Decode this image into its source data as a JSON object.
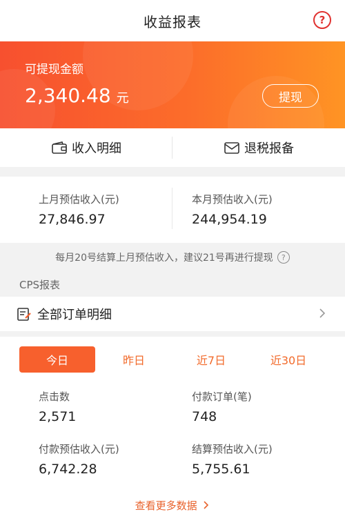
{
  "header": {
    "title": "收益报表",
    "help_icon": "?"
  },
  "balance": {
    "label": "可提现金额",
    "amount": "2,340.48",
    "unit": "元",
    "withdraw_label": "提现"
  },
  "quick_actions": [
    {
      "label": "收入明细",
      "icon": "wallet-icon"
    },
    {
      "label": "退税报备",
      "icon": "envelope-icon"
    }
  ],
  "estimates": {
    "last_month": {
      "label": "上月预估收入(元)",
      "value": "27,846.97"
    },
    "this_month": {
      "label": "本月预估收入(元)",
      "value": "244,954.19"
    }
  },
  "note": {
    "text": "每月20号结算上月预估收入，建议21号再进行提现",
    "icon": "?"
  },
  "section": {
    "label": "CPS报表"
  },
  "orders": {
    "title": "全部订单明细"
  },
  "tabs": [
    {
      "label": "今日",
      "active": true
    },
    {
      "label": "昨日",
      "active": false
    },
    {
      "label": "近7日",
      "active": false
    },
    {
      "label": "近30日",
      "active": false
    }
  ],
  "metrics": {
    "clicks": {
      "label": "点击数",
      "value": "2,571"
    },
    "paid_orders": {
      "label": "付款订单(笔)",
      "value": "748"
    },
    "paid_estimate": {
      "label": "付款预估收入(元)",
      "value": "6,742.28"
    },
    "settled_estimate": {
      "label": "结算预估收入(元)",
      "value": "5,755.61"
    }
  },
  "more_link": {
    "label": "查看更多数据"
  },
  "colors": {
    "accent": "#f7602d",
    "help": "#e0312f"
  }
}
